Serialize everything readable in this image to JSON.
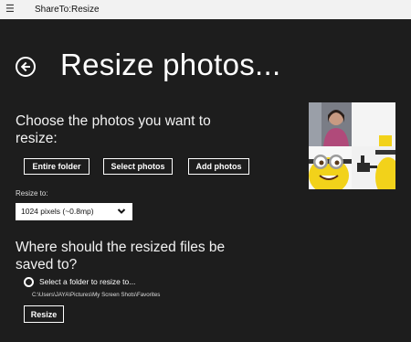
{
  "titlebar": {
    "menu_icon": "hamburger-icon",
    "app_title": "ShareTo:Resize"
  },
  "header": {
    "back_icon": "back-arrow-circle-icon",
    "title": "Resize photos..."
  },
  "choose": {
    "heading": "Choose the photos you want to resize:",
    "buttons": {
      "entire_folder": "Entire folder",
      "select_photos": "Select photos",
      "add_photos": "Add photos"
    }
  },
  "resize_to": {
    "label": "Resize to:",
    "selected": "1024 pixels (~0.8mp)",
    "chevron_icon": "chevron-down-icon"
  },
  "destination": {
    "heading": "Where should the resized files be saved to?",
    "radio_label": "Select a folder to resize to...",
    "path": "C:\\Users\\JAYA\\Pictures\\My Screen Shots\\Favorites"
  },
  "action": {
    "resize_label": "Resize"
  },
  "colors": {
    "background": "#1d1d1d",
    "titlebar": "#f2f2f2",
    "text": "#ffffff",
    "minion_yellow": "#f2d21a"
  }
}
